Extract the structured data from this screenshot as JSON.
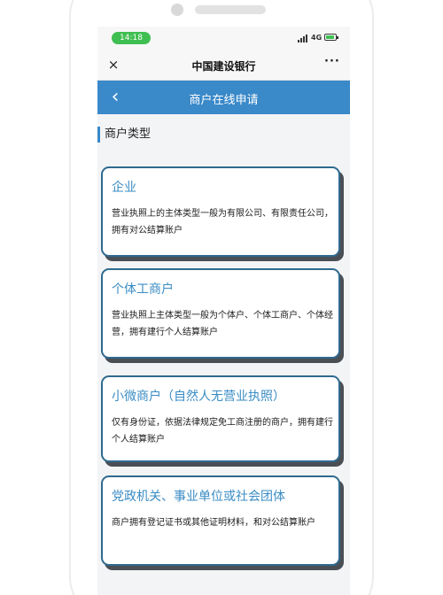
{
  "status_bar": {
    "time": "14:18",
    "network": "4G",
    "accent_color": "#3fbf52"
  },
  "app_bar": {
    "close_icon": "×",
    "title": "中国建设银行",
    "more_icon": "···"
  },
  "header": {
    "back_icon": "‹",
    "title": "商户在线申请",
    "color": "#3a89c9"
  },
  "section": {
    "title": "商户类型"
  },
  "cards": [
    {
      "title": "企业",
      "description": "营业执照上的主体类型一般为有限公司、有限责任公司，拥有对公结算账户"
    },
    {
      "title": "个体工商户",
      "description": "营业执照上主体类型一般为个体户、个体工商户、个体经营，拥有建行个人结算账户"
    },
    {
      "title": "小微商户（自然人无营业执照）",
      "description": "仅有身份证，依据法律规定免工商注册的商户，拥有建行个人结算账户"
    },
    {
      "title": "党政机关、事业单位或社会团体",
      "description": "商户拥有登记证书或其他证明材料，和对公结算账户"
    }
  ],
  "colors": {
    "card_title": "#3a8cc4",
    "card_border": "#2f6a8f"
  }
}
